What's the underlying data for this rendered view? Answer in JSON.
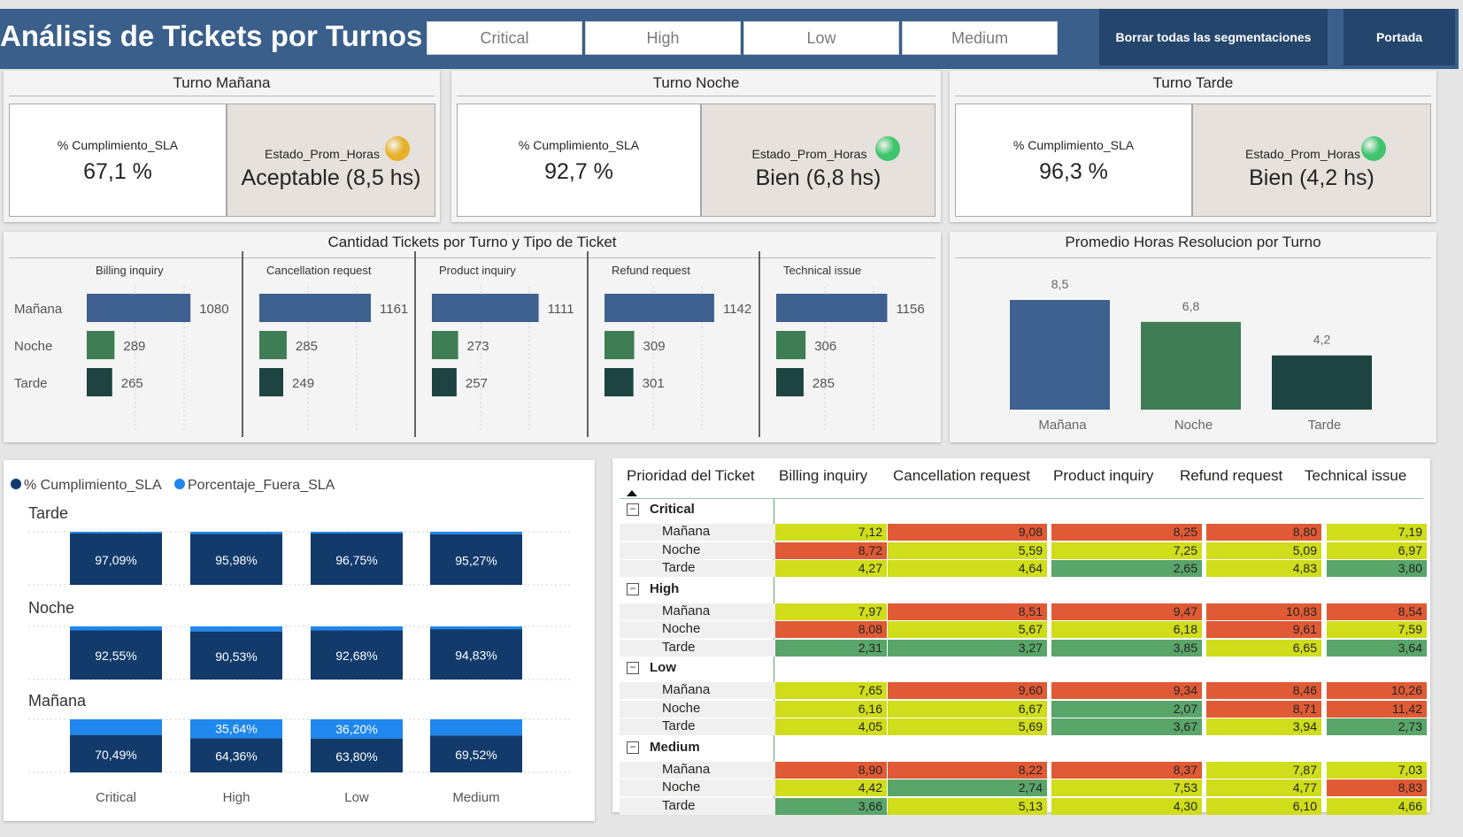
{
  "header": {
    "title": "Análisis de Tickets por Turnos",
    "slicers": [
      "Critical",
      "High",
      "Low",
      "Medium"
    ],
    "clear_button": "Borrar todas las segmentaciones",
    "home_button": "Portada"
  },
  "kpis": [
    {
      "title": "Turno Mañana",
      "sla_label": "% Cumplimiento_SLA",
      "sla_value": "67,1 %",
      "estado_label": "Estado_Prom_Horas",
      "estado_value": "Aceptable (8,5 hs)",
      "dot_color": "#e7b02a"
    },
    {
      "title": "Turno Noche",
      "sla_label": "% Cumplimiento_SLA",
      "sla_value": "92,7 %",
      "estado_label": "Estado_Prom_Horas",
      "estado_value": "Bien (6,8 hs)",
      "dot_color": "#3fc46d"
    },
    {
      "title": "Turno Tarde",
      "sla_label": "% Cumplimiento_SLA",
      "sla_value": "96,3 %",
      "estado_label": "Estado_Prom_Horas",
      "estado_value": "Bien (4,2 hs)",
      "dot_color": "#3fc46d"
    }
  ],
  "colors": {
    "manana": "#3e6190",
    "noche": "#3f7d55",
    "tarde": "#1d4440",
    "sla_dark": "#123a6b",
    "sla_light": "#1f87ee",
    "heat_red": "#e05a35",
    "heat_yellow": "#cfdd1b",
    "heat_green": "#59a56a"
  },
  "chart_data": [
    {
      "type": "bar",
      "title": "Cantidad Tickets por Turno y Tipo de Ticket",
      "categories": [
        "Mañana",
        "Noche",
        "Tarde"
      ],
      "panels": [
        {
          "name": "Billing inquiry",
          "values": [
            1080,
            289,
            265
          ]
        },
        {
          "name": "Cancellation request",
          "values": [
            1161,
            285,
            249
          ]
        },
        {
          "name": "Product inquiry",
          "values": [
            1111,
            273,
            257
          ]
        },
        {
          "name": "Refund request",
          "values": [
            1142,
            309,
            301
          ]
        },
        {
          "name": "Technical issue",
          "values": [
            1156,
            306,
            285
          ]
        }
      ]
    },
    {
      "type": "bar",
      "title": "Promedio Horas Resolucion por Turno",
      "categories": [
        "Mañana",
        "Noche",
        "Tarde"
      ],
      "values": [
        8.5,
        6.8,
        4.2
      ],
      "value_labels": [
        "8,5",
        "6,8",
        "4,2"
      ]
    },
    {
      "type": "bar",
      "subtype": "100% stacked",
      "legend": [
        "% Cumplimiento_SLA",
        "Porcentaje_Fuera_SLA"
      ],
      "legend_position": "top-left",
      "categories": [
        "Critical",
        "High",
        "Low",
        "Medium"
      ],
      "panels": [
        {
          "name": "Tarde",
          "sla": [
            97.09,
            95.98,
            96.75,
            95.27
          ],
          "sla_labels": [
            "97,09%",
            "95,98%",
            "96,75%",
            "95,27%"
          ],
          "fuera_labels": [
            "",
            "",
            "",
            ""
          ]
        },
        {
          "name": "Noche",
          "sla": [
            92.55,
            90.53,
            92.68,
            94.83
          ],
          "sla_labels": [
            "92,55%",
            "90,53%",
            "92,68%",
            "94,83%"
          ],
          "fuera_labels": [
            "",
            "",
            "",
            ""
          ]
        },
        {
          "name": "Mañana",
          "sla": [
            70.49,
            64.36,
            63.8,
            69.52
          ],
          "sla_labels": [
            "70,49%",
            "64,36%",
            "63,80%",
            "69,52%"
          ],
          "fuera_labels": [
            "",
            "35,64%",
            "36,20%",
            ""
          ]
        }
      ]
    },
    {
      "type": "heatmap",
      "row_header": "Prioridad del Ticket",
      "columns": [
        "Billing inquiry",
        "Cancellation request",
        "Product inquiry",
        "Refund request",
        "Technical issue"
      ],
      "groups": [
        {
          "name": "Critical",
          "rows": [
            {
              "label": "Mañana",
              "values": [
                "7,12",
                "9,08",
                "8,25",
                "8,80",
                "7,19"
              ],
              "colors": [
                "y",
                "r",
                "r",
                "r",
                "y"
              ]
            },
            {
              "label": "Noche",
              "values": [
                "8,72",
                "5,59",
                "7,25",
                "5,09",
                "6,97"
              ],
              "colors": [
                "r",
                "y",
                "y",
                "y",
                "y"
              ]
            },
            {
              "label": "Tarde",
              "values": [
                "4,27",
                "4,64",
                "2,65",
                "4,83",
                "3,80"
              ],
              "colors": [
                "y",
                "y",
                "g",
                "y",
                "g"
              ]
            }
          ]
        },
        {
          "name": "High",
          "rows": [
            {
              "label": "Mañana",
              "values": [
                "7,97",
                "8,51",
                "9,47",
                "10,83",
                "8,54"
              ],
              "colors": [
                "y",
                "r",
                "r",
                "r",
                "r"
              ]
            },
            {
              "label": "Noche",
              "values": [
                "8,08",
                "5,67",
                "6,18",
                "9,61",
                "7,59"
              ],
              "colors": [
                "r",
                "y",
                "y",
                "r",
                "y"
              ]
            },
            {
              "label": "Tarde",
              "values": [
                "2,31",
                "3,27",
                "3,85",
                "6,65",
                "3,64"
              ],
              "colors": [
                "g",
                "g",
                "g",
                "y",
                "g"
              ]
            }
          ]
        },
        {
          "name": "Low",
          "rows": [
            {
              "label": "Mañana",
              "values": [
                "7,65",
                "9,60",
                "9,34",
                "8,46",
                "10,26"
              ],
              "colors": [
                "y",
                "r",
                "r",
                "r",
                "r"
              ]
            },
            {
              "label": "Noche",
              "values": [
                "6,16",
                "6,67",
                "2,07",
                "8,71",
                "11,42"
              ],
              "colors": [
                "y",
                "y",
                "g",
                "r",
                "r"
              ]
            },
            {
              "label": "Tarde",
              "values": [
                "4,05",
                "5,69",
                "3,67",
                "3,94",
                "2,73"
              ],
              "colors": [
                "y",
                "y",
                "g",
                "y",
                "g"
              ]
            }
          ]
        },
        {
          "name": "Medium",
          "rows": [
            {
              "label": "Mañana",
              "values": [
                "8,90",
                "8,22",
                "8,37",
                "7,87",
                "7,03"
              ],
              "colors": [
                "r",
                "r",
                "r",
                "y",
                "y"
              ]
            },
            {
              "label": "Noche",
              "values": [
                "4,42",
                "2,74",
                "7,53",
                "4,77",
                "8,83"
              ],
              "colors": [
                "y",
                "g",
                "y",
                "y",
                "r"
              ]
            },
            {
              "label": "Tarde",
              "values": [
                "3,66",
                "5,13",
                "4,30",
                "6,10",
                "4,66"
              ],
              "colors": [
                "g",
                "y",
                "y",
                "y",
                "y"
              ]
            }
          ]
        }
      ]
    }
  ]
}
